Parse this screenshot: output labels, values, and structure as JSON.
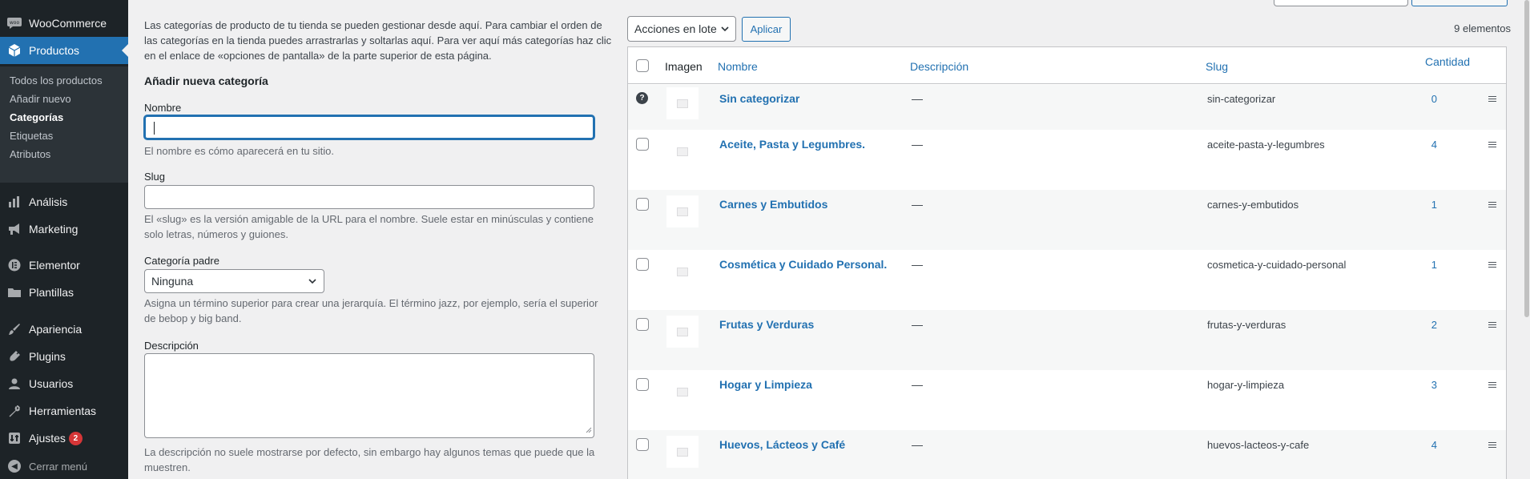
{
  "sidebar": {
    "items": [
      {
        "label": "WooCommerce",
        "icon": "woo-icon"
      },
      {
        "label": "Productos",
        "icon": "box-icon",
        "active": true
      },
      {
        "label": "Análisis",
        "icon": "bar-chart-icon"
      },
      {
        "label": "Marketing",
        "icon": "megaphone-icon"
      },
      {
        "label": "Elementor",
        "icon": "elementor-icon"
      },
      {
        "label": "Plantillas",
        "icon": "folder-icon"
      },
      {
        "label": "Apariencia",
        "icon": "brush-icon"
      },
      {
        "label": "Plugins",
        "icon": "plug-icon"
      },
      {
        "label": "Usuarios",
        "icon": "user-icon"
      },
      {
        "label": "Herramientas",
        "icon": "wrench-icon"
      },
      {
        "label": "Ajustes",
        "icon": "settings-icon",
        "badge": "2"
      }
    ],
    "submenu": [
      "Todos los productos",
      "Añadir nuevo",
      "Categorías",
      "Etiquetas",
      "Atributos"
    ],
    "collapse_label": "Cerrar menú"
  },
  "form": {
    "intro": "Las categorías de producto de tu tienda se pueden gestionar desde aquí. Para cambiar el orden de las categorías en la tienda puedes arrastrarlas y soltarlas aquí. Para ver aquí más categorías haz clic en el enlace de «opciones de pantalla» de la parte superior de esta página.",
    "heading": "Añadir nueva categoría",
    "name_label": "Nombre",
    "name_help": "El nombre es cómo aparecerá en tu sitio.",
    "slug_label": "Slug",
    "slug_help": "El «slug» es la versión amigable de la URL para el nombre. Suele estar en minúsculas y contiene solo letras, números y guiones.",
    "parent_label": "Categoría padre",
    "parent_value": "Ninguna",
    "parent_help": "Asigna un término superior para crear una jerarquía. El término jazz, por ejemplo, sería el superior de bebop y big band.",
    "desc_label": "Descripción",
    "desc_help": "La descripción no suele mostrarse por defecto, sin embargo hay algunos temas que puede que la muestren."
  },
  "list": {
    "bulk_value": "Acciones en lote",
    "apply_label": "Aplicar",
    "count_text": "9 elementos",
    "columns": {
      "image": "Imagen",
      "name": "Nombre",
      "description": "Descripción",
      "slug": "Slug",
      "count": "Cantidad"
    },
    "rows": [
      {
        "name": "Sin categorizar",
        "desc": "—",
        "slug": "sin-categorizar",
        "count": "0"
      },
      {
        "name": "Aceite, Pasta y Legumbres.",
        "desc": "—",
        "slug": "aceite-pasta-y-legumbres",
        "count": "4"
      },
      {
        "name": "Carnes y Embutidos",
        "desc": "—",
        "slug": "carnes-y-embutidos",
        "count": "1"
      },
      {
        "name": "Cosmética y Cuidado Personal.",
        "desc": "—",
        "slug": "cosmetica-y-cuidado-personal",
        "count": "1"
      },
      {
        "name": "Frutas y Verduras",
        "desc": "—",
        "slug": "frutas-y-verduras",
        "count": "2"
      },
      {
        "name": "Hogar y Limpieza",
        "desc": "—",
        "slug": "hogar-y-limpieza",
        "count": "3"
      },
      {
        "name": "Huevos, Lácteos y Café",
        "desc": "—",
        "slug": "huevos-lacteos-y-cafe",
        "count": "4"
      }
    ]
  },
  "colors": {
    "accent": "#2271b1",
    "sidebar_bg": "#1d2327",
    "badge": "#d63638"
  }
}
